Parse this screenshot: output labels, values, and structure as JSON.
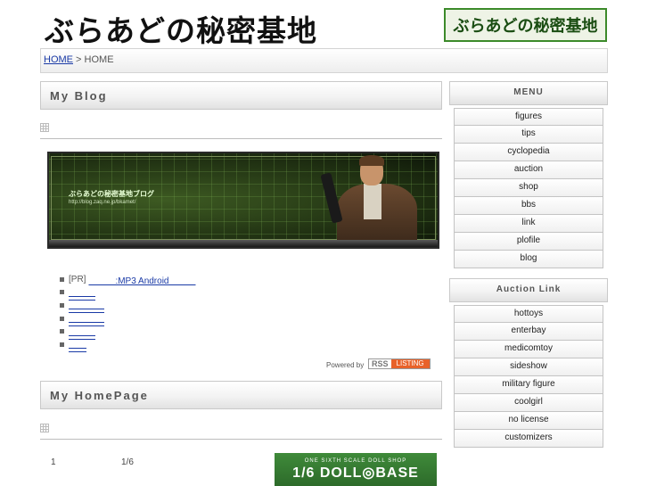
{
  "header": {
    "site_title": "ぶらあどの秘密基地",
    "logo_text": "ぶらあどの秘密基地"
  },
  "breadcrumb": {
    "home_link": "HOME",
    "separator": " > ",
    "current": "HOME"
  },
  "blog": {
    "heading": "My Blog",
    "banner": {
      "title": "ぶらあどの秘密基地ブログ",
      "url": "http://blog.zaq.ne.jp/bkamet/"
    },
    "pr_list": {
      "pr_tag": "[PR]",
      "first_link": "　　　:MP3 Android　　　",
      "items": [
        "　　　",
        "　　　　",
        "　　　　",
        "　　　",
        "　　"
      ]
    },
    "powered_by": "Powered by",
    "rss_label": "RSS",
    "listing_label": "LISTING"
  },
  "homepage": {
    "heading": "My HomePage",
    "left_value": "1",
    "mid_value": "1/6",
    "doll_banner_top": "ONE SIXTH SCALE DOLL SHOP",
    "doll_banner_main": "1/6 DOLL◎BASE"
  },
  "sidebar": {
    "menu_heading": "MENU",
    "menu_items": [
      "figures",
      "tips",
      "cyclopedia",
      "auction",
      "shop",
      "bbs",
      "link",
      "plofile",
      "blog"
    ],
    "auction_heading": "Auction Link",
    "auction_items": [
      "hottoys",
      "enterbay",
      "medicomtoy",
      "sideshow",
      "military figure",
      "coolgirl",
      "no license",
      "customizers"
    ]
  },
  "colors": {
    "logo_border": "#3c8a2a",
    "link": "#1a3aa6",
    "rss_listing": "#e8622a",
    "doll_banner": "#3f8a3a"
  }
}
